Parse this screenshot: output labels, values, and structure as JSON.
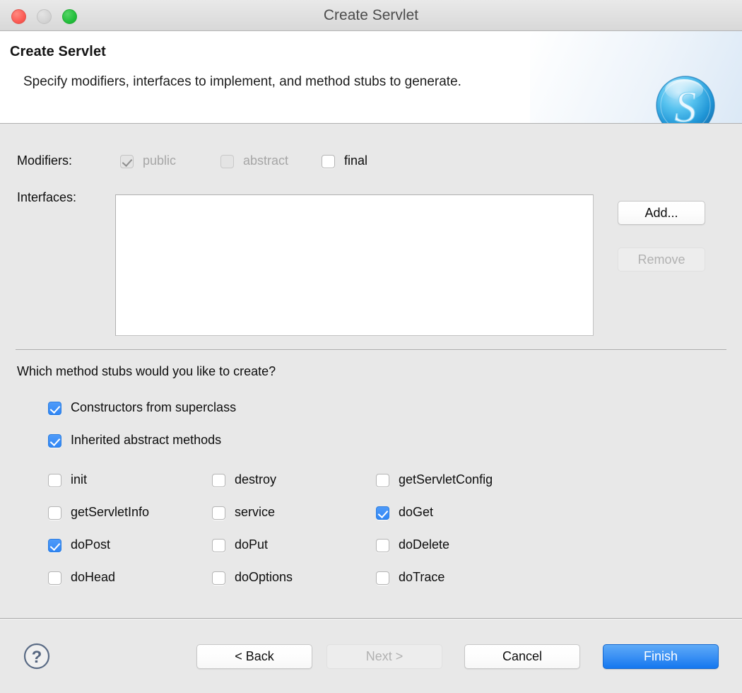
{
  "window": {
    "title": "Create Servlet",
    "controls": {
      "close": "close-button",
      "minimize": "minimize-button",
      "maximize": "maximize-button"
    }
  },
  "header": {
    "title": "Create Servlet",
    "subtitle": "Specify modifiers, interfaces to implement, and method stubs to generate.",
    "logo_letter": "S"
  },
  "form": {
    "modifiers_label": "Modifiers:",
    "modifiers": [
      {
        "label": "public",
        "checked": true,
        "enabled": false
      },
      {
        "label": "abstract",
        "checked": false,
        "enabled": false
      },
      {
        "label": "final",
        "checked": false,
        "enabled": true
      }
    ],
    "interfaces_label": "Interfaces:",
    "interfaces_items": [],
    "add_label": "Add...",
    "remove_label": "Remove",
    "remove_enabled": false
  },
  "stubs": {
    "question": "Which method stubs would you like to create?",
    "top_options": [
      {
        "label": "Constructors from superclass",
        "checked": true
      },
      {
        "label": "Inherited abstract methods",
        "checked": true
      }
    ],
    "columns": [
      [
        {
          "label": "init",
          "checked": false
        },
        {
          "label": "getServletInfo",
          "checked": false
        },
        {
          "label": "doPost",
          "checked": true
        },
        {
          "label": "doHead",
          "checked": false
        }
      ],
      [
        {
          "label": "destroy",
          "checked": false
        },
        {
          "label": "service",
          "checked": false
        },
        {
          "label": "doPut",
          "checked": false
        },
        {
          "label": "doOptions",
          "checked": false
        }
      ],
      [
        {
          "label": "getServletConfig",
          "checked": false
        },
        {
          "label": "doGet",
          "checked": true
        },
        {
          "label": "doDelete",
          "checked": false
        },
        {
          "label": "doTrace",
          "checked": false
        }
      ]
    ]
  },
  "footer": {
    "help": "?",
    "back_label": "< Back",
    "next_label": "Next >",
    "next_enabled": false,
    "cancel_label": "Cancel",
    "finish_label": "Finish"
  },
  "colors": {
    "accent": "#2f86f5",
    "primary_button": "#3d92f4",
    "window_bg": "#e8e8e8",
    "header_bg": "#ffffff",
    "logo_blue": "#2aa3e0"
  }
}
